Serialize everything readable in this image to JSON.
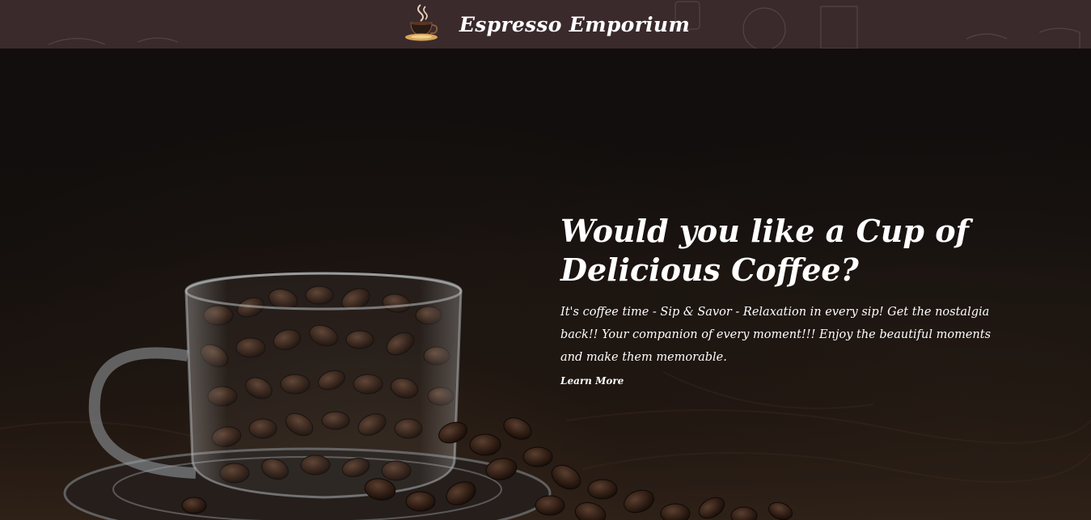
{
  "header": {
    "brand_name": "Espresso Emporium",
    "logo_icon": "coffee-cup-logo-icon",
    "background_color": "#3a2a2b"
  },
  "hero": {
    "headline": "Would you like a Cup of Delicious Coffee?",
    "description": "It's coffee time - Sip & Savor - Relaxation in every sip! Get the nostalgia back!! Your companion of every moment!!! Enjoy the beautiful moments and make them memorable.",
    "cta_label": "Learn More",
    "image": "glass-cup-of-coffee-beans-image"
  }
}
